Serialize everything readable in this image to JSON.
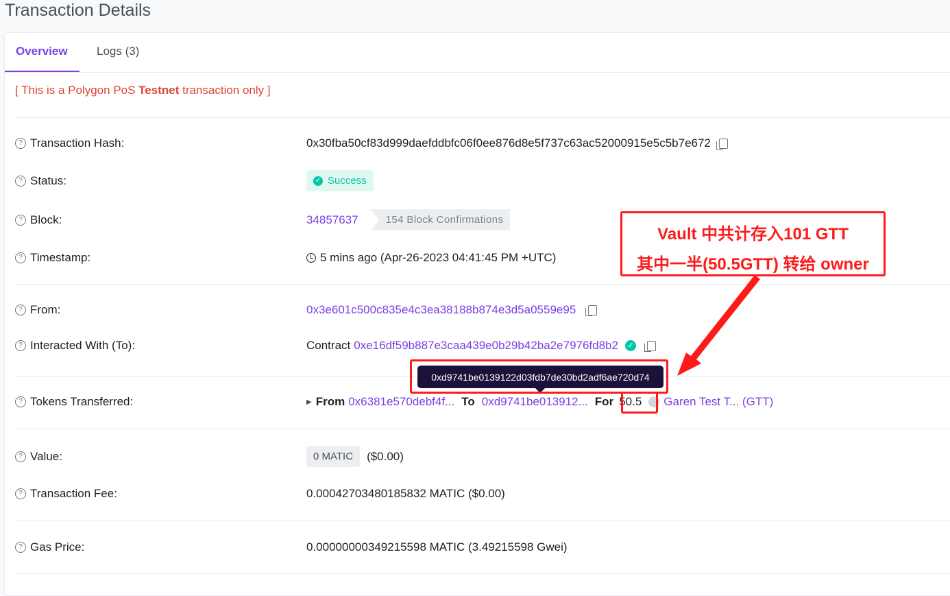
{
  "page": {
    "title": "Transaction Details"
  },
  "tabs": {
    "overview": "Overview",
    "logs": "Logs (3)"
  },
  "notice": {
    "prefix": "[ This is a Polygon PoS ",
    "bold": "Testnet",
    "suffix": " transaction only ]"
  },
  "rows": {
    "hash": {
      "label": "Transaction Hash:",
      "value": "0x30fba50cf83d999daefddbfc06f0ee876d8e5f737c63ac52000915e5c5b7e672"
    },
    "status": {
      "label": "Status:",
      "value": "Success"
    },
    "block": {
      "label": "Block:",
      "number": "34857637",
      "confirmations": "154 Block Confirmations"
    },
    "timestamp": {
      "label": "Timestamp:",
      "value": "5 mins ago (Apr-26-2023 04:41:45 PM +UTC)"
    },
    "from": {
      "label": "From:",
      "value": "0x3e601c500c835e4c3ea38188b874e3d5a0559e95"
    },
    "to": {
      "label": "Interacted With (To):",
      "prefix": "Contract",
      "value": "0xe16df59b887e3caa439e0b29b42ba2e7976fd8b2"
    },
    "tokens": {
      "label": "Tokens Transferred:",
      "from_label": "From",
      "from_value": "0x6381e570debf4f...",
      "to_label": "To",
      "to_value": "0xd9741be013912...",
      "for_label": "For",
      "amount": "50.5",
      "token": "Garen Test T... (GTT)"
    },
    "value": {
      "label": "Value:",
      "badge": "0 MATIC",
      "usd": "($0.00)"
    },
    "fee": {
      "label": "Transaction Fee:",
      "value": "0.00042703480185832 MATIC ($0.00)"
    },
    "gas": {
      "label": "Gas Price:",
      "value": "0.00000000349215598 MATIC (3.49215598 Gwei)"
    }
  },
  "tooltip": {
    "text": "0xd9741be0139122d03fdb7de30bd2adf6ae720d74"
  },
  "annotation": {
    "line1": "Vault 中共计存入101 GTT",
    "line2": "其中一半(50.5GTT) 转给 owner",
    "color": "#ff1a1a"
  },
  "colors": {
    "accent": "#7b3fe4",
    "success": "#00c9a7",
    "danger": "#de4437"
  }
}
